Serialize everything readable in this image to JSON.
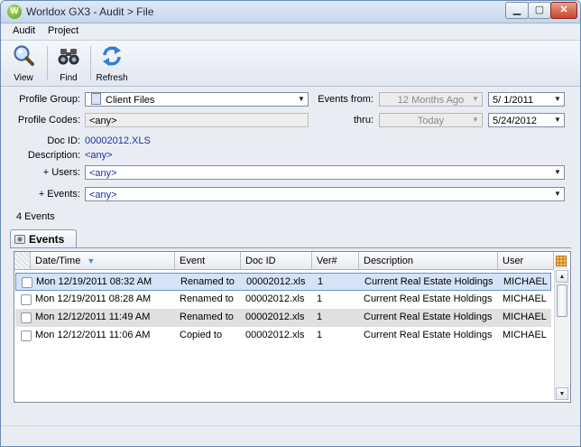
{
  "window": {
    "title": "Worldox GX3 - Audit > File",
    "app_icon_letter": "W",
    "minimize": "▁",
    "maximize": "▢",
    "close": "✕"
  },
  "menu": [
    "Audit",
    "Project"
  ],
  "toolbar": {
    "view": {
      "label": "View",
      "icon": "magnifier-icon"
    },
    "find": {
      "label": "Find",
      "icon": "binoculars-icon"
    },
    "refresh": {
      "label": "Refresh",
      "icon": "refresh-icon"
    }
  },
  "filters": {
    "profile_group_label": "Profile Group:",
    "profile_group_value": "Client Files",
    "profile_codes_label": "Profile Codes:",
    "profile_codes_value": "<any>",
    "doc_id_label": "Doc ID:",
    "doc_id_value": "00002012.XLS",
    "description_label": "Description:",
    "description_value": "<any>",
    "users_label": "+ Users:",
    "users_value": "<any>",
    "events_label": "+ Events:",
    "events_value": "<any>",
    "events_from_label": "Events from:",
    "events_from_value": "12 Months Ago",
    "from_date": "5/  1/2011",
    "thru_label": "thru:",
    "thru_value": "Today",
    "thru_date": "5/24/2012"
  },
  "events_count": "4  Events",
  "tab": {
    "label": "Events"
  },
  "table": {
    "headers": [
      "Date/Time",
      "Event",
      "Doc ID",
      "Ver#",
      "Description",
      "User"
    ],
    "rows": [
      [
        "Mon 12/19/2011 08:32 AM",
        "Renamed to",
        "00002012.xls",
        "1",
        "Current Real Estate Holdings",
        "MICHAEL"
      ],
      [
        "Mon 12/19/2011 08:28 AM",
        "Renamed to",
        "00002012.xls",
        "1",
        "Current Real Estate Holdings",
        "MICHAEL"
      ],
      [
        "Mon 12/12/2011 11:49 AM",
        "Renamed to",
        "00002012.xls",
        "1",
        "Current Real Estate Holdings",
        "MICHAEL"
      ],
      [
        "Mon 12/12/2011 11:06 AM",
        "Copied to",
        "00002012.xls",
        "1",
        "Current Real Estate Holdings",
        "MICHAEL"
      ]
    ]
  },
  "colors": {
    "accent": "#1f2fa6",
    "selected_row": "#d4e3f7"
  }
}
